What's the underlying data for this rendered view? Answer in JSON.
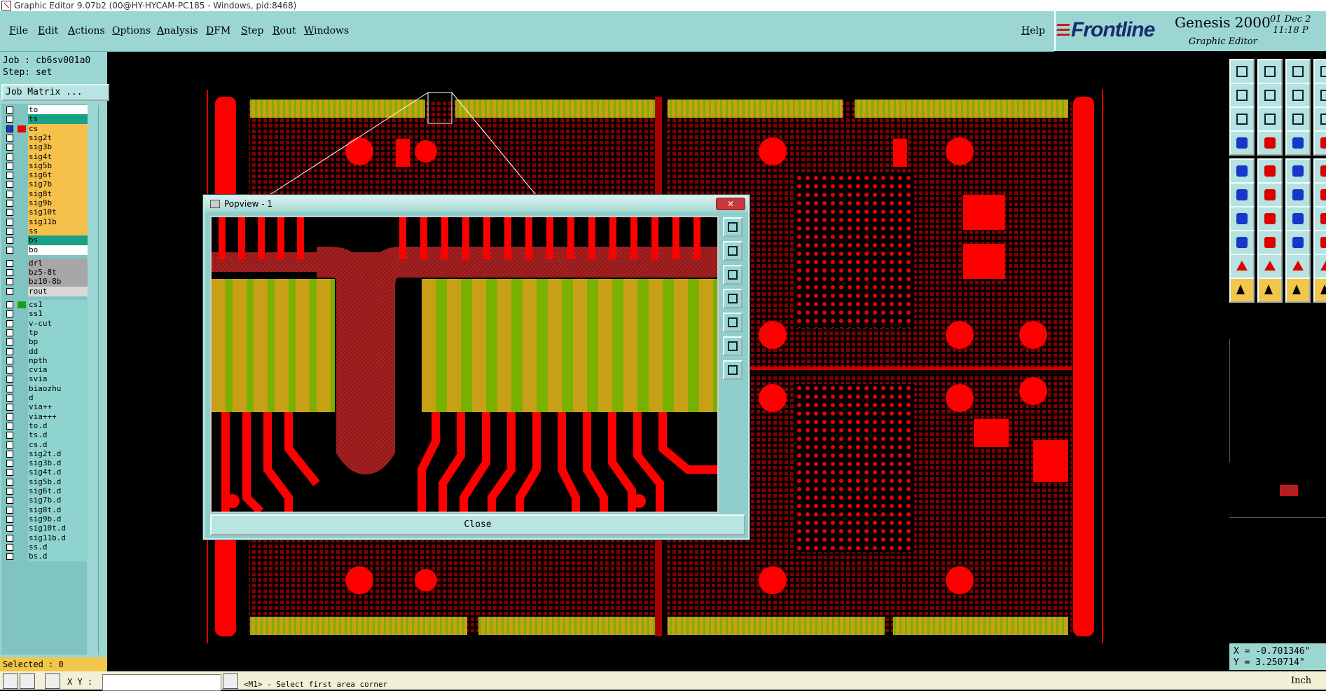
{
  "window": {
    "title": "Graphic Editor 9.07b2 (00@HY-HYCAM-PC185 - Windows, pid:8468)"
  },
  "menu": [
    "File",
    "Edit",
    "Actions",
    "Options",
    "Analysis",
    "DFM",
    "Step",
    "Rout",
    "Windows"
  ],
  "help": "Help",
  "brand": {
    "logo": "Frontline",
    "product": "Genesis 2000",
    "subtitle": "Graphic Editor",
    "date": "01 Dec 2\n 11:18 P"
  },
  "job": {
    "job_label": "Job : cb6sv001a0",
    "step_label": "Step: set",
    "matrix_button": "Job Matrix ..."
  },
  "layers": [
    {
      "name": "to",
      "color": "#ffffff"
    },
    {
      "name": "ts",
      "color": "#19a085"
    },
    {
      "name": "cs",
      "color": "#f5c14a",
      "active": true
    },
    {
      "name": "sig2t",
      "color": "#f5c14a"
    },
    {
      "name": "sig3b",
      "color": "#f5c14a"
    },
    {
      "name": "sig4t",
      "color": "#f5c14a"
    },
    {
      "name": "sig5b",
      "color": "#f5c14a"
    },
    {
      "name": "sig6t",
      "color": "#f5c14a"
    },
    {
      "name": "sig7b",
      "color": "#f5c14a"
    },
    {
      "name": "sig8t",
      "color": "#f5c14a"
    },
    {
      "name": "sig9b",
      "color": "#f5c14a"
    },
    {
      "name": "sig10t",
      "color": "#f5c14a"
    },
    {
      "name": "sig11b",
      "color": "#f5c14a"
    },
    {
      "name": "ss",
      "color": "#f5c14a"
    },
    {
      "name": "bs",
      "color": "#19a085"
    },
    {
      "name": "bo",
      "color": "#ffffff"
    },
    {
      "name": "drl",
      "color": "#a7a7a7",
      "gap": true
    },
    {
      "name": "bz5-8t",
      "color": "#a7a7a7"
    },
    {
      "name": "bz10-8b",
      "color": "#a7a7a7"
    },
    {
      "name": "rout",
      "color": "#d8d8d8"
    },
    {
      "name": "cs1",
      "color": "#8fd3cf",
      "gap": true,
      "checked": true
    },
    {
      "name": "ss1",
      "color": "#8fd3cf"
    },
    {
      "name": "v-cut",
      "color": "#8fd3cf"
    },
    {
      "name": "tp",
      "color": "#8fd3cf"
    },
    {
      "name": "bp",
      "color": "#8fd3cf"
    },
    {
      "name": "dd",
      "color": "#8fd3cf"
    },
    {
      "name": "npth",
      "color": "#8fd3cf"
    },
    {
      "name": "cvia",
      "color": "#8fd3cf"
    },
    {
      "name": "svia",
      "color": "#8fd3cf"
    },
    {
      "name": "biaozhu",
      "color": "#8fd3cf"
    },
    {
      "name": "d",
      "color": "#8fd3cf"
    },
    {
      "name": "via++",
      "color": "#8fd3cf"
    },
    {
      "name": "via+++",
      "color": "#8fd3cf"
    },
    {
      "name": "to.d",
      "color": "#8fd3cf"
    },
    {
      "name": "ts.d",
      "color": "#8fd3cf"
    },
    {
      "name": "cs.d",
      "color": "#8fd3cf"
    },
    {
      "name": "sig2t.d",
      "color": "#8fd3cf"
    },
    {
      "name": "sig3b.d",
      "color": "#8fd3cf"
    },
    {
      "name": "sig4t.d",
      "color": "#8fd3cf"
    },
    {
      "name": "sig5b.d",
      "color": "#8fd3cf"
    },
    {
      "name": "sig6t.d",
      "color": "#8fd3cf"
    },
    {
      "name": "sig7b.d",
      "color": "#8fd3cf"
    },
    {
      "name": "sig8t.d",
      "color": "#8fd3cf"
    },
    {
      "name": "sig9b.d",
      "color": "#8fd3cf"
    },
    {
      "name": "sig10t.d",
      "color": "#8fd3cf"
    },
    {
      "name": "sig11b.d",
      "color": "#8fd3cf"
    },
    {
      "name": "ss.d",
      "color": "#8fd3cf"
    },
    {
      "name": "bs.d",
      "color": "#8fd3cf"
    }
  ],
  "selected_label": "Selected : 0",
  "xy_label": "X Y :",
  "xy_value": "",
  "status": "<M1> - Select first area corner",
  "popview": {
    "title": "Popview - 1",
    "close": "Close"
  },
  "coords": {
    "x": "X = -0.701346\"",
    "y": "Y = 3.250714\""
  },
  "unit": "Inch",
  "colors": {
    "board_red": "#ff0000",
    "gold_finger": "#c8a018",
    "gold_green": "#7ab000",
    "panel": "#9bd6d3",
    "highlight": "#f2c64a"
  }
}
